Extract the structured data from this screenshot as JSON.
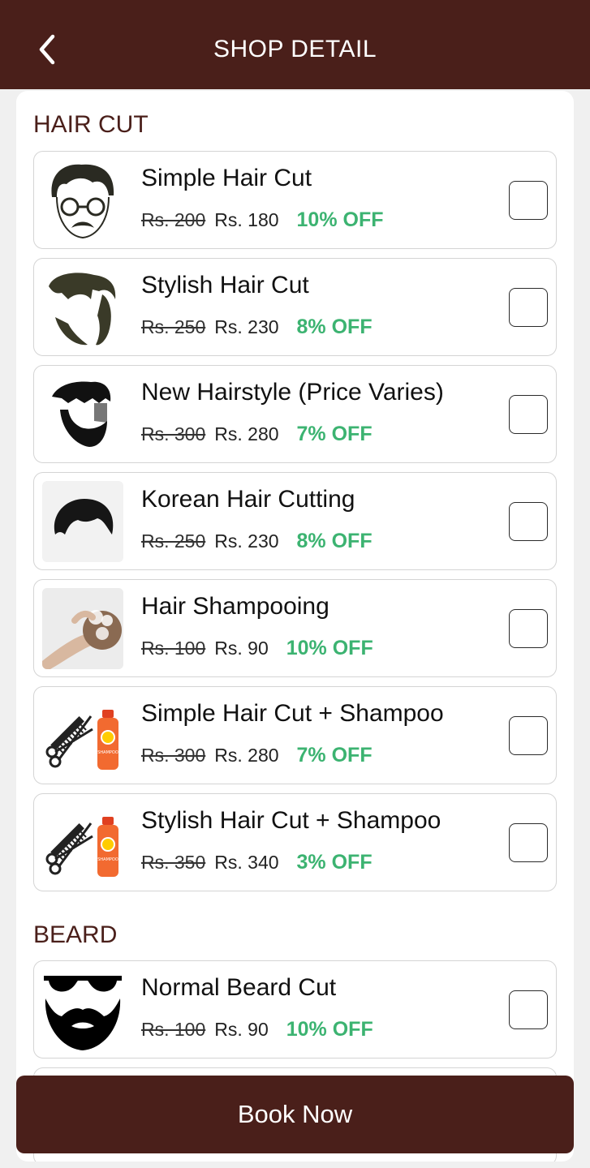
{
  "header": {
    "title": "SHOP DETAIL"
  },
  "sections": {
    "haircut": {
      "title": "HAIR CUT"
    },
    "beard": {
      "title": "BEARD"
    }
  },
  "services": [
    {
      "name": "Simple Hair Cut",
      "old_price": "Rs. 200",
      "new_price": "Rs. 180",
      "discount": "10% OFF",
      "icon": "glasses-face-icon"
    },
    {
      "name": "Stylish Hair Cut",
      "old_price": "Rs. 250",
      "new_price": "Rs. 230",
      "discount": "8% OFF",
      "icon": "stylish-hair-beard-icon"
    },
    {
      "name": "New Hairstyle (Price Varies)",
      "old_price": "Rs. 300",
      "new_price": "Rs. 280",
      "discount": "7% OFF",
      "icon": "hairstyle-beard-icon"
    },
    {
      "name": "Korean Hair Cutting",
      "old_price": "Rs. 250",
      "new_price": "Rs. 230",
      "discount": "8% OFF",
      "icon": "korean-hair-icon"
    },
    {
      "name": "Hair Shampooing",
      "old_price": "Rs. 100",
      "new_price": "Rs. 90",
      "discount": "10% OFF",
      "icon": "shampooing-photo-icon"
    },
    {
      "name": "Simple Hair Cut + Shampoo",
      "old_price": "Rs. 300",
      "new_price": "Rs. 280",
      "discount": "7% OFF",
      "icon": "scissors-comb-shampoo-icon"
    },
    {
      "name": "Stylish Hair Cut + Shampoo",
      "old_price": "Rs. 350",
      "new_price": "Rs. 340",
      "discount": "3% OFF",
      "icon": "scissors-comb-shampoo-icon"
    },
    {
      "name": "Normal Beard Cut",
      "old_price": "Rs. 100",
      "new_price": "Rs. 90",
      "discount": "10% OFF",
      "icon": "beard-sunglasses-icon"
    }
  ],
  "shampoo_label": "SHAMPOO",
  "footer": {
    "book_label": "Book Now"
  },
  "colors": {
    "primary": "#4a1f1a",
    "discount": "#3cb371"
  }
}
